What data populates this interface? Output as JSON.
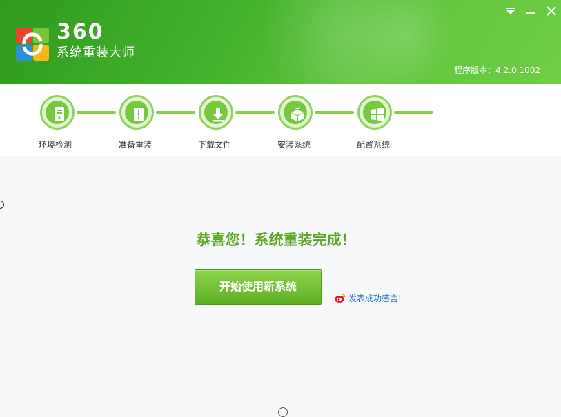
{
  "app": {
    "brand_number": "360",
    "brand_name": "系统重装大师",
    "version_text": "程序版本：4.2.0.1002",
    "colors": {
      "header_green": "#44b22c",
      "accent_green": "#5aa726",
      "link_blue": "#1a6fc4"
    }
  },
  "window_controls": {
    "menu_icon": "menu-dropdown-icon",
    "minimize_icon": "minimize-icon",
    "close_icon": "close-icon"
  },
  "steps": [
    {
      "label": "环境检测",
      "icon": "computer-check-icon"
    },
    {
      "label": "准备重装",
      "icon": "prepare-icon"
    },
    {
      "label": "下载文件",
      "icon": "download-icon"
    },
    {
      "label": "安装系统",
      "icon": "install-box-icon"
    },
    {
      "label": "配置系统",
      "icon": "windows-config-icon"
    }
  ],
  "main": {
    "congrats_text": "恭喜您！系统重装完成！",
    "start_button_label": "开始使用新系统",
    "share_link_text": "发表成功感言!",
    "share_icon": "weibo-icon"
  }
}
